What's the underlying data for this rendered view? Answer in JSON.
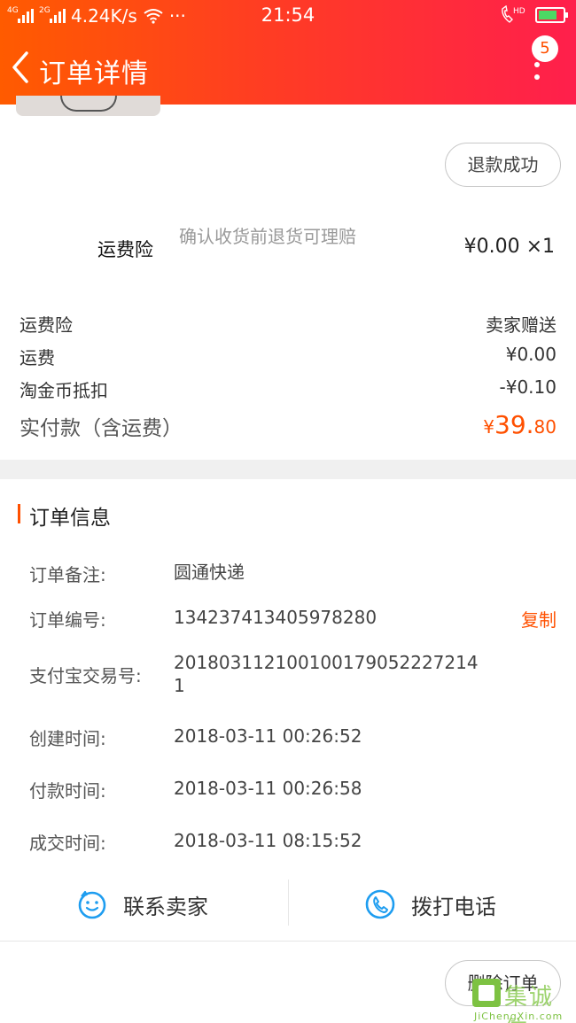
{
  "status_bar": {
    "net_left_1": "4G",
    "net_left_2": "2G",
    "speed": "4.24K/s",
    "more": "···",
    "time": "21:54",
    "hd": "HD"
  },
  "header": {
    "title": "订单详情",
    "badge_count": "5",
    "accent": "#ff5000"
  },
  "refund": {
    "label": "退款成功"
  },
  "insurance_item": {
    "title": "运费险",
    "description": "确认收货前退货可理赔",
    "price": "¥0.00 ×1"
  },
  "fees": {
    "rows": [
      {
        "label": "运费险",
        "value": "卖家赠送"
      },
      {
        "label": "运费",
        "value": "¥0.00"
      },
      {
        "label": "淘金币抵扣",
        "value": "-¥0.10"
      }
    ],
    "total_label": "实付款（含运费）",
    "total_currency": "¥",
    "total_integer": "39.",
    "total_decimal": "80"
  },
  "order_info": {
    "section_title": "订单信息",
    "rows": [
      {
        "label": "订单备注:",
        "value": "圆通快递"
      },
      {
        "label": "订单编号:",
        "value": "134237413405978280"
      },
      {
        "label": "支付宝交易号:",
        "value": "2018031121001001790522272141"
      },
      {
        "label": "创建时间:",
        "value": "2018-03-11 00:26:52"
      },
      {
        "label": "付款时间:",
        "value": "2018-03-11 00:26:58"
      },
      {
        "label": "成交时间:",
        "value": "2018-03-11 08:15:52"
      }
    ],
    "copy_label": "复制"
  },
  "contact": {
    "seller_label": "联系卖家",
    "phone_label": "拨打电话",
    "icon_color": "#1e9df0"
  },
  "footer": {
    "delete_label": "删除订单"
  },
  "watermark": {
    "text": "集诚信",
    "url": "JiChengXin.com"
  }
}
